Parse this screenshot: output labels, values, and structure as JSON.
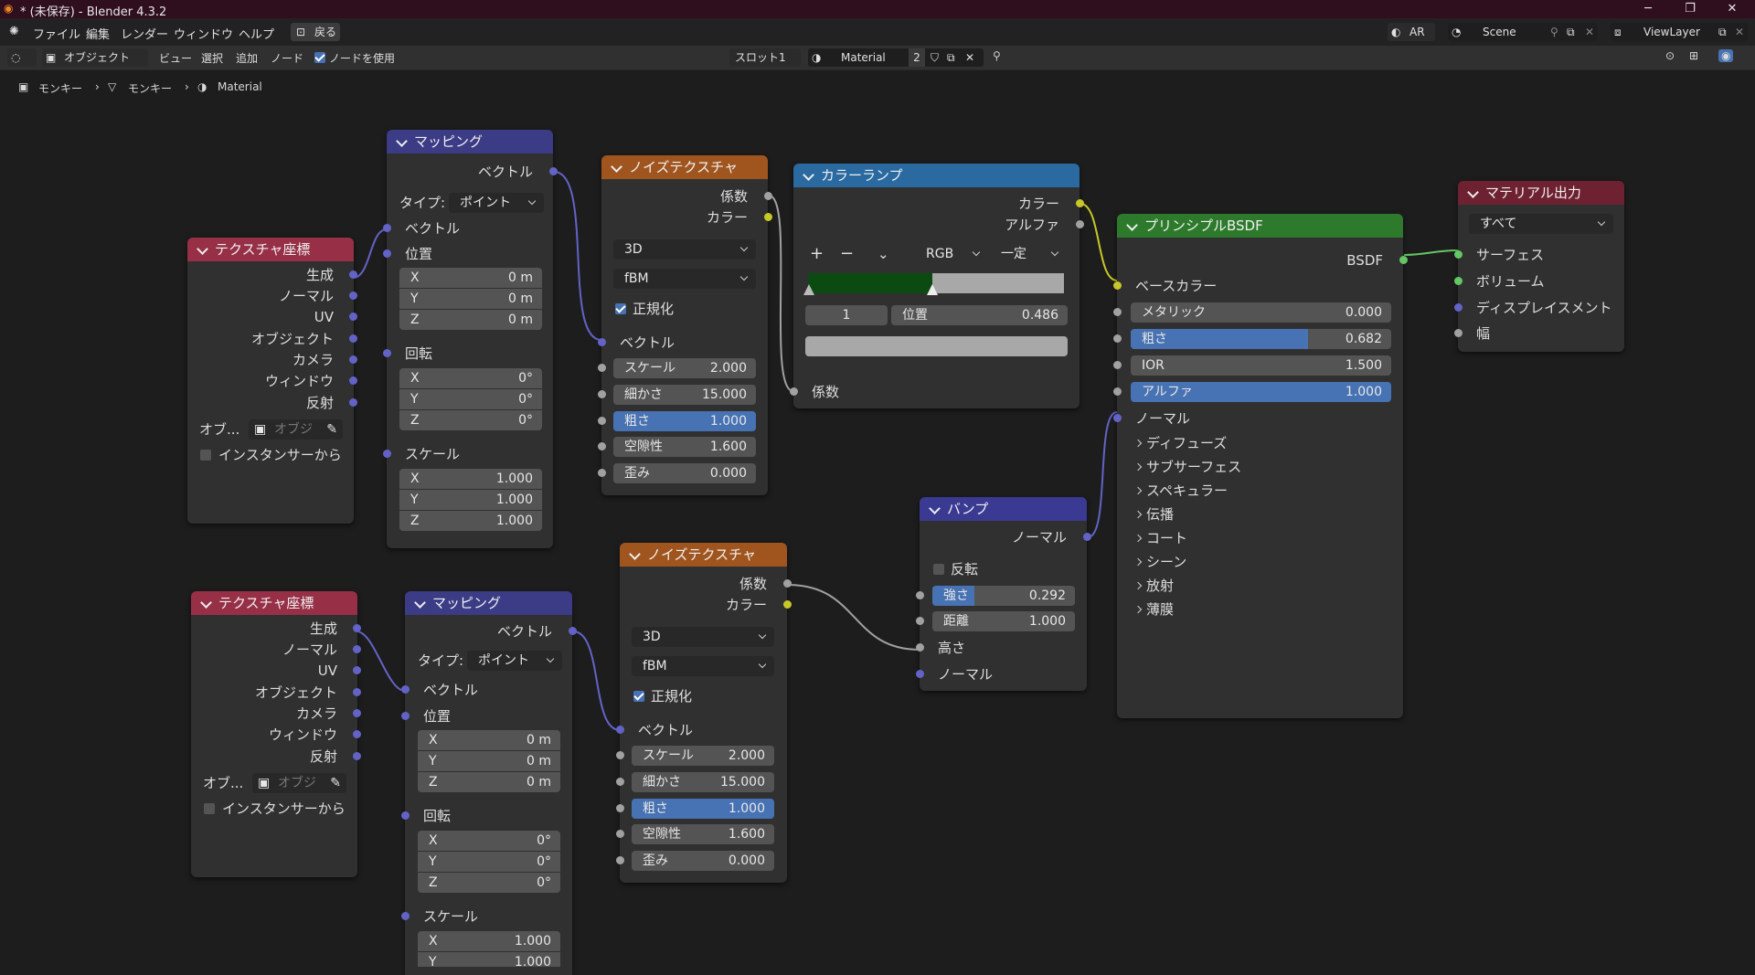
{
  "window": {
    "title": "* (未保存) - Blender 4.3.2",
    "controls": [
      "─",
      "❐",
      "✕"
    ]
  },
  "menubar": {
    "items": [
      "ファイル",
      "編集",
      "レンダー",
      "ウィンドウ",
      "ヘルプ"
    ],
    "back_label": "戻る",
    "ar_label": "AR",
    "scene_name": "Scene",
    "viewlayer_name": "ViewLayer"
  },
  "header": {
    "mode": "オブジェクト",
    "menus": [
      "ビュー",
      "選択",
      "追加",
      "ノード"
    ],
    "use_nodes_label": "ノードを使用",
    "use_nodes_checked": true,
    "slot": "スロット1",
    "material_name": "Material",
    "user_count": "2"
  },
  "breadcrumb": [
    "モンキー",
    "モンキー",
    "Material"
  ],
  "nodes": {
    "texcoord1": {
      "title": "テクスチャ座標",
      "outputs": [
        "生成",
        "ノーマル",
        "UV",
        "オブジェクト",
        "カメラ",
        "ウィンドウ",
        "反射"
      ],
      "object_label": "オブ...",
      "object_placeholder": "オブジ",
      "from_instancer": "インスタンサーから"
    },
    "mapping1": {
      "title": "マッピング",
      "output": "ベクトル",
      "type_label": "タイプ:",
      "type_value": "ポイント",
      "vector_in": "ベクトル",
      "location": "位置",
      "loc": [
        {
          "k": "X",
          "v": "0 m"
        },
        {
          "k": "Y",
          "v": "0 m"
        },
        {
          "k": "Z",
          "v": "0 m"
        }
      ],
      "rotation": "回転",
      "rot": [
        {
          "k": "X",
          "v": "0°"
        },
        {
          "k": "Y",
          "v": "0°"
        },
        {
          "k": "Z",
          "v": "0°"
        }
      ],
      "scale": "スケール",
      "scl": [
        {
          "k": "X",
          "v": "1.000"
        },
        {
          "k": "Y",
          "v": "1.000"
        },
        {
          "k": "Z",
          "v": "1.000"
        }
      ]
    },
    "noise1": {
      "title": "ノイズテクスチャ",
      "out_fac": "係数",
      "out_color": "カラー",
      "dim": "3D",
      "type": "fBM",
      "normalize": "正規化",
      "vector": "ベクトル",
      "fields": [
        {
          "k": "スケール",
          "v": "2.000"
        },
        {
          "k": "細かさ",
          "v": "15.000"
        },
        {
          "k": "粗さ",
          "v": "1.000"
        },
        {
          "k": "空隙性",
          "v": "1.600"
        },
        {
          "k": "歪み",
          "v": "0.000"
        }
      ],
      "roughness_value": 1.0
    },
    "ramp": {
      "title": "カラーランプ",
      "out_color": "カラー",
      "out_alpha": "アルファ",
      "plus": "+",
      "minus": "−",
      "mode": "RGB",
      "interp": "一定",
      "stop_index": "1",
      "pos_label": "位置",
      "pos_value": "0.486",
      "in_fac": "係数",
      "stop_color_left": "#0b4a10",
      "stop_color_right": "#a8a8a8",
      "position": 0.486
    },
    "bsdf": {
      "title": "プリンシプルBSDF",
      "output": "BSDF",
      "base_color": "ベースカラー",
      "fields": [
        {
          "k": "メタリック",
          "v": "0.000"
        },
        {
          "k": "粗さ",
          "v": "0.682"
        },
        {
          "k": "IOR",
          "v": "1.500"
        },
        {
          "k": "アルファ",
          "v": "1.000"
        }
      ],
      "roughness_value": 0.682,
      "alpha_value": 1.0,
      "normal": "ノーマル",
      "panels": [
        "ディフューズ",
        "サブサーフェス",
        "スペキュラー",
        "伝播",
        "コート",
        "シーン",
        "放射",
        "薄膜"
      ]
    },
    "output": {
      "title": "マテリアル出力",
      "target": "すべて",
      "inputs": [
        "サーフェス",
        "ボリューム",
        "ディスプレイスメント",
        "幅"
      ]
    },
    "bump": {
      "title": "バンプ",
      "output": "ノーマル",
      "invert": "反転",
      "fields": [
        {
          "k": "強さ",
          "v": "0.292"
        },
        {
          "k": "距離",
          "v": "1.000"
        }
      ],
      "strength_value": 0.292,
      "height": "高さ",
      "normal_in": "ノーマル"
    },
    "texcoord2": {
      "title": "テクスチャ座標",
      "outputs": [
        "生成",
        "ノーマル",
        "UV",
        "オブジェクト",
        "カメラ",
        "ウィンドウ",
        "反射"
      ],
      "object_label": "オブ...",
      "object_placeholder": "オブジ",
      "from_instancer": "インスタンサーから"
    },
    "mapping2": {
      "title": "マッピング",
      "output": "ベクトル",
      "type_label": "タイプ:",
      "type_value": "ポイント",
      "vector_in": "ベクトル",
      "location": "位置",
      "loc": [
        {
          "k": "X",
          "v": "0 m"
        },
        {
          "k": "Y",
          "v": "0 m"
        },
        {
          "k": "Z",
          "v": "0 m"
        }
      ],
      "rotation": "回転",
      "rot": [
        {
          "k": "X",
          "v": "0°"
        },
        {
          "k": "Y",
          "v": "0°"
        },
        {
          "k": "Z",
          "v": "0°"
        }
      ],
      "scale": "スケール",
      "scl": [
        {
          "k": "X",
          "v": "1.000"
        },
        {
          "k": "Y",
          "v": "1.000"
        }
      ]
    },
    "noise2": {
      "title": "ノイズテクスチャ",
      "out_fac": "係数",
      "out_color": "カラー",
      "dim": "3D",
      "type": "fBM",
      "normalize": "正規化",
      "vector": "ベクトル",
      "fields": [
        {
          "k": "スケール",
          "v": "2.000"
        },
        {
          "k": "細かさ",
          "v": "15.000"
        },
        {
          "k": "粗さ",
          "v": "1.000"
        },
        {
          "k": "空隙性",
          "v": "1.600"
        },
        {
          "k": "歪み",
          "v": "0.000"
        }
      ],
      "roughness_value": 1.0
    }
  }
}
